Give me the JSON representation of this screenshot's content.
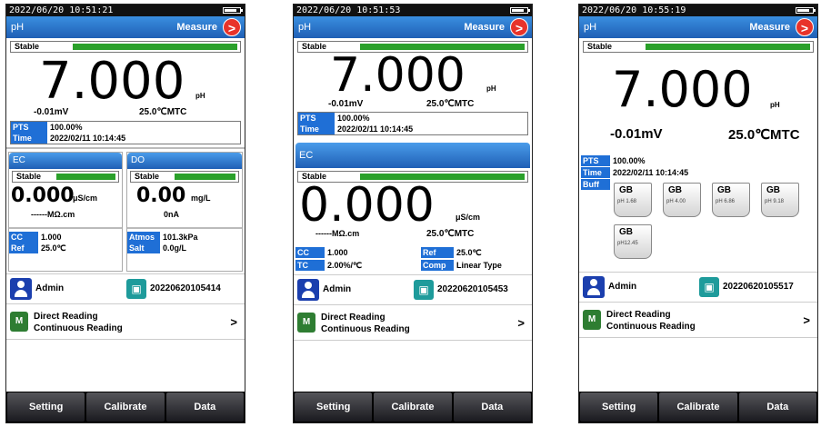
{
  "nav": {
    "setting": "Setting",
    "calibrate": "Calibrate",
    "data": "Data"
  },
  "user": {
    "name": "Admin"
  },
  "mode": {
    "line1": "Direct Reading",
    "line2": "Continuous Reading",
    "chevron": ">"
  },
  "stable_label": "Stable",
  "ph_title": "pH",
  "measure_label": "Measure",
  "arrow": ">",
  "screens": [
    {
      "time": "2022/06/20 10:51:21",
      "ph": {
        "value": "7.000",
        "unit": "pH",
        "mv": "-0.01mV",
        "temp": "25.0℃MTC"
      },
      "pts_label": "PTS",
      "pts_value": "100.00%",
      "time_label": "Time",
      "time_value": "2022/02/11  10:14:45",
      "ec": {
        "title": "EC",
        "value": "0.000",
        "unit": "μS/cm",
        "res": "------MΩ.cm",
        "cc_label": "CC",
        "cc_value": "1.000",
        "ref_label": "Ref",
        "ref_value": "25.0℃"
      },
      "do": {
        "title": "DO",
        "value": "0.00",
        "unit": "mg/L",
        "current": "0nA",
        "atmos_label": "Atmos",
        "atmos_value": "101.3kPa",
        "salt_label": "Salt",
        "salt_value": "0.0g/L"
      },
      "sample": "20220620105414"
    },
    {
      "time": "2022/06/20 10:51:53",
      "ph": {
        "value": "7.000",
        "unit": "pH",
        "mv": "-0.01mV",
        "temp": "25.0℃MTC"
      },
      "pts_label": "PTS",
      "pts_value": "100.00%",
      "time_label": "Time",
      "time_value": "2022/02/11  10:14:45",
      "ec": {
        "title": "EC",
        "value": "0.000",
        "unit": "μS/cm",
        "res": "------MΩ.cm",
        "cc_label": "CC",
        "cc_value": "1.000",
        "ref_label": "Ref",
        "ref_value": "25.0℃",
        "tc_label": "TC",
        "tc_value": "2.00%/℃",
        "comp_label": "Comp",
        "comp_value": "Linear Type"
      },
      "sample": "20220620105453"
    },
    {
      "time": "2022/06/20 10:55:19",
      "ph": {
        "value": "7.000",
        "unit": "pH",
        "mv": "-0.01mV",
        "temp": "25.0℃MTC"
      },
      "pts_label": "PTS",
      "pts_value": "100.00%",
      "time_label": "Time",
      "time_value": "2022/02/11  10:14:45",
      "buff_label": "Buff",
      "buffers": [
        {
          "name": "GB",
          "ph": "pH 1.68"
        },
        {
          "name": "GB",
          "ph": "pH 4.00"
        },
        {
          "name": "GB",
          "ph": "pH 6.86"
        },
        {
          "name": "GB",
          "ph": "pH 9.18"
        },
        {
          "name": "GB",
          "ph": "pH12.45"
        }
      ],
      "sample": "20220620105517"
    }
  ]
}
